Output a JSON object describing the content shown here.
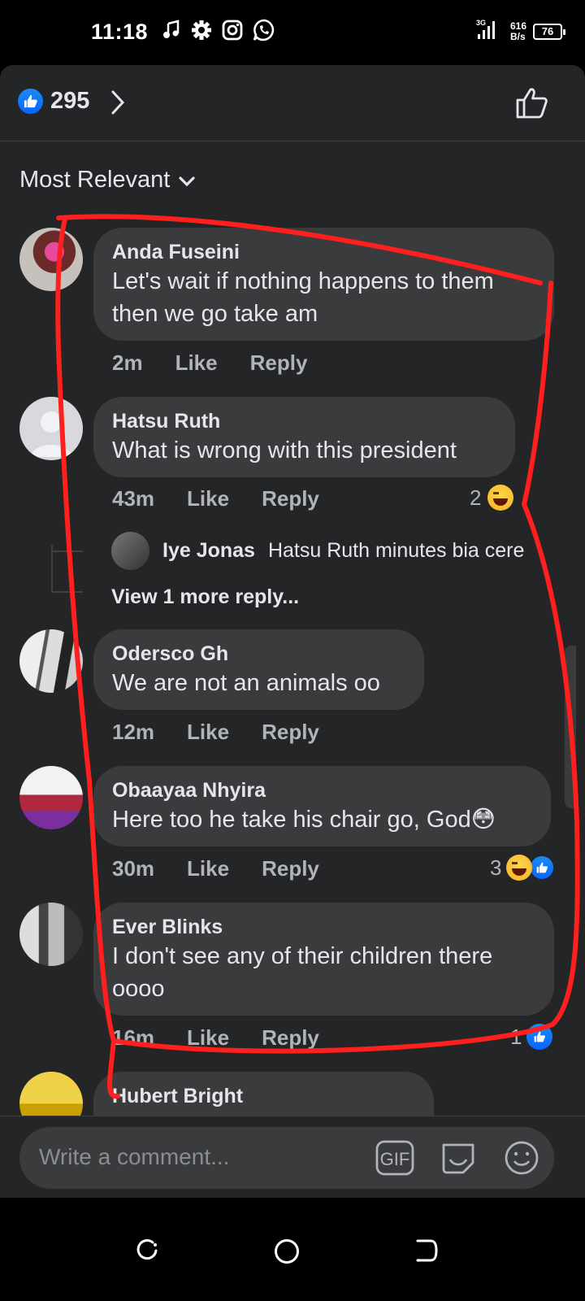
{
  "status_bar": {
    "time": "11:18",
    "network_type": "3G",
    "speed_value": "616",
    "speed_unit": "B/s",
    "battery": "76",
    "icons": [
      "music-note-icon",
      "gear-icon",
      "instagram-icon",
      "whatsapp-icon"
    ]
  },
  "header": {
    "reaction_count": "295",
    "icons": [
      "like-reaction-icon",
      "chevron-right-icon",
      "thumbs-up-outline-icon"
    ]
  },
  "sort": {
    "label": "Most Relevant"
  },
  "comments": [
    {
      "name": "Anda Fuseini",
      "text_lines": [
        "Let's wait if nothing happens to them",
        "then we go take am"
      ],
      "time": "2m",
      "like": "Like",
      "reply": "Reply"
    },
    {
      "name": "Hatsu Ruth",
      "text_lines": [
        "What is wrong with this president"
      ],
      "time": "43m",
      "like": "Like",
      "reply": "Reply",
      "reaction_count": "2",
      "reactions": [
        "haha"
      ],
      "replies": {
        "preview_name": "Iye Jonas",
        "preview_text": "Hatsu Ruth minutes bia cere",
        "view_more": "View 1 more reply..."
      }
    },
    {
      "name": "Odersco Gh",
      "text_lines": [
        "We are not an animals oo"
      ],
      "time": "12m",
      "like": "Like",
      "reply": "Reply"
    },
    {
      "name": "Obaayaa Nhyira",
      "text_lines": [
        "Here too he take his chair go, God😳"
      ],
      "time": "30m",
      "like": "Like",
      "reply": "Reply",
      "reaction_count": "3",
      "reactions": [
        "haha",
        "like"
      ]
    },
    {
      "name": "Ever Blinks",
      "text_lines": [
        "I don't see any of their children there",
        "oooo"
      ],
      "time": "16m",
      "like": "Like",
      "reply": "Reply",
      "reaction_count": "1",
      "reactions": [
        "like"
      ]
    },
    {
      "name": "Hubert Bright",
      "text_lines": []
    }
  ],
  "composer": {
    "placeholder": "Write a comment...",
    "gif_label": "GIF",
    "icons": [
      "gif-icon",
      "sticker-icon",
      "emoji-icon"
    ]
  },
  "nav_bar": {
    "icons": [
      "recent-apps-icon",
      "home-icon",
      "back-icon"
    ]
  },
  "colors": {
    "sheet_bg": "#242526",
    "bubble_bg": "#3a3b3c",
    "text_primary": "#e4e6eb",
    "text_secondary": "#b0b3b8",
    "accent_blue": "#0866ff",
    "annotation_red": "#ff1f1f"
  }
}
